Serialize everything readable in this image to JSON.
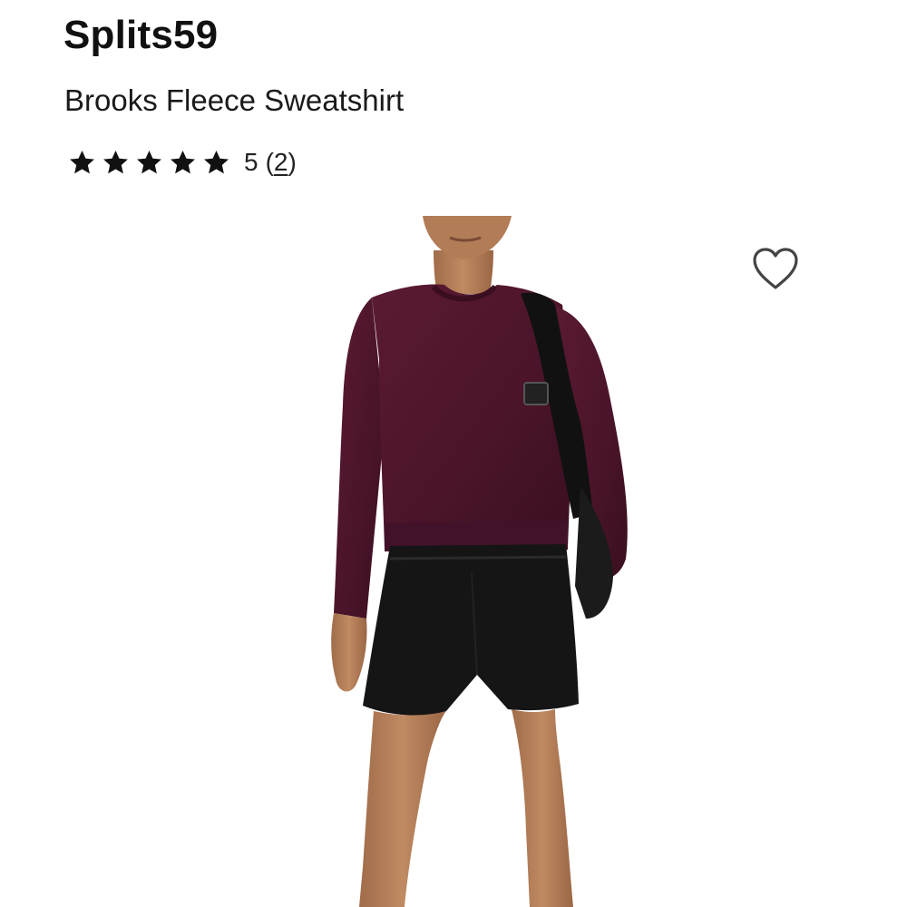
{
  "product": {
    "brand": "Splits59",
    "name": "Brooks Fleece Sweatshirt",
    "rating": {
      "stars_filled": 5,
      "stars_total": 5,
      "value": "5",
      "count_open": "(",
      "count": "2",
      "count_close": ")"
    }
  },
  "icons": {
    "star": "star-icon",
    "wishlist": "heart-outline-icon"
  },
  "colors": {
    "text": "#111111",
    "sweatshirt": "#4a1429",
    "shorts": "#151515",
    "skin": "#b07a55"
  }
}
